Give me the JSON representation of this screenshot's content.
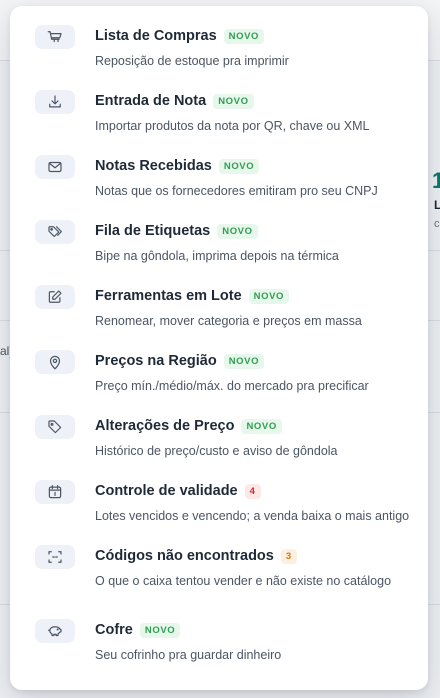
{
  "background": {
    "fragment_left": "al)",
    "stat_number": "1",
    "stat_label": "L",
    "stat_sub": "c"
  },
  "menu": {
    "items": [
      {
        "icon": "cart-icon",
        "title": "Lista de Compras",
        "badge": "NOVO",
        "badge_color": "green",
        "description": "Reposição de estoque pra imprimir"
      },
      {
        "icon": "download-icon",
        "title": "Entrada de Nota",
        "badge": "NOVO",
        "badge_color": "green",
        "description": "Importar produtos da nota por QR, chave ou XML"
      },
      {
        "icon": "mail-icon",
        "title": "Notas Recebidas",
        "badge": "NOVO",
        "badge_color": "green",
        "description": "Notas que os fornecedores emitiram pro seu CNPJ"
      },
      {
        "icon": "tags-icon",
        "title": "Fila de Etiquetas",
        "badge": "NOVO",
        "badge_color": "green",
        "description": "Bipe na gôndola, imprima depois na térmica"
      },
      {
        "icon": "edit-icon",
        "title": "Ferramentas em Lote",
        "badge": "NOVO",
        "badge_color": "green",
        "description": "Renomear, mover categoria e preços em massa"
      },
      {
        "icon": "map-pin-icon",
        "title": "Preços na Região",
        "badge": "NOVO",
        "badge_color": "green",
        "description": "Preço mín./médio/máx. do mercado pra precificar"
      },
      {
        "icon": "tag-icon",
        "title": "Alterações de Preço",
        "badge": "NOVO",
        "badge_color": "green",
        "description": "Histórico de preço/custo e aviso de gôndola"
      },
      {
        "icon": "calendar-icon",
        "title": "Controle de validade",
        "badge": "4",
        "badge_color": "red",
        "description": "Lotes vencidos e vencendo; a venda baixa o mais antigo"
      },
      {
        "icon": "scan-icon",
        "title": "Códigos não encontrados",
        "badge": "3",
        "badge_color": "orange",
        "description": "O que o caixa tentou vender e não existe no catálogo"
      },
      {
        "icon": "piggy-bank-icon",
        "title": "Cofre",
        "badge": "NOVO",
        "badge_color": "green",
        "description": "Seu cofrinho pra guardar dinheiro"
      }
    ]
  }
}
